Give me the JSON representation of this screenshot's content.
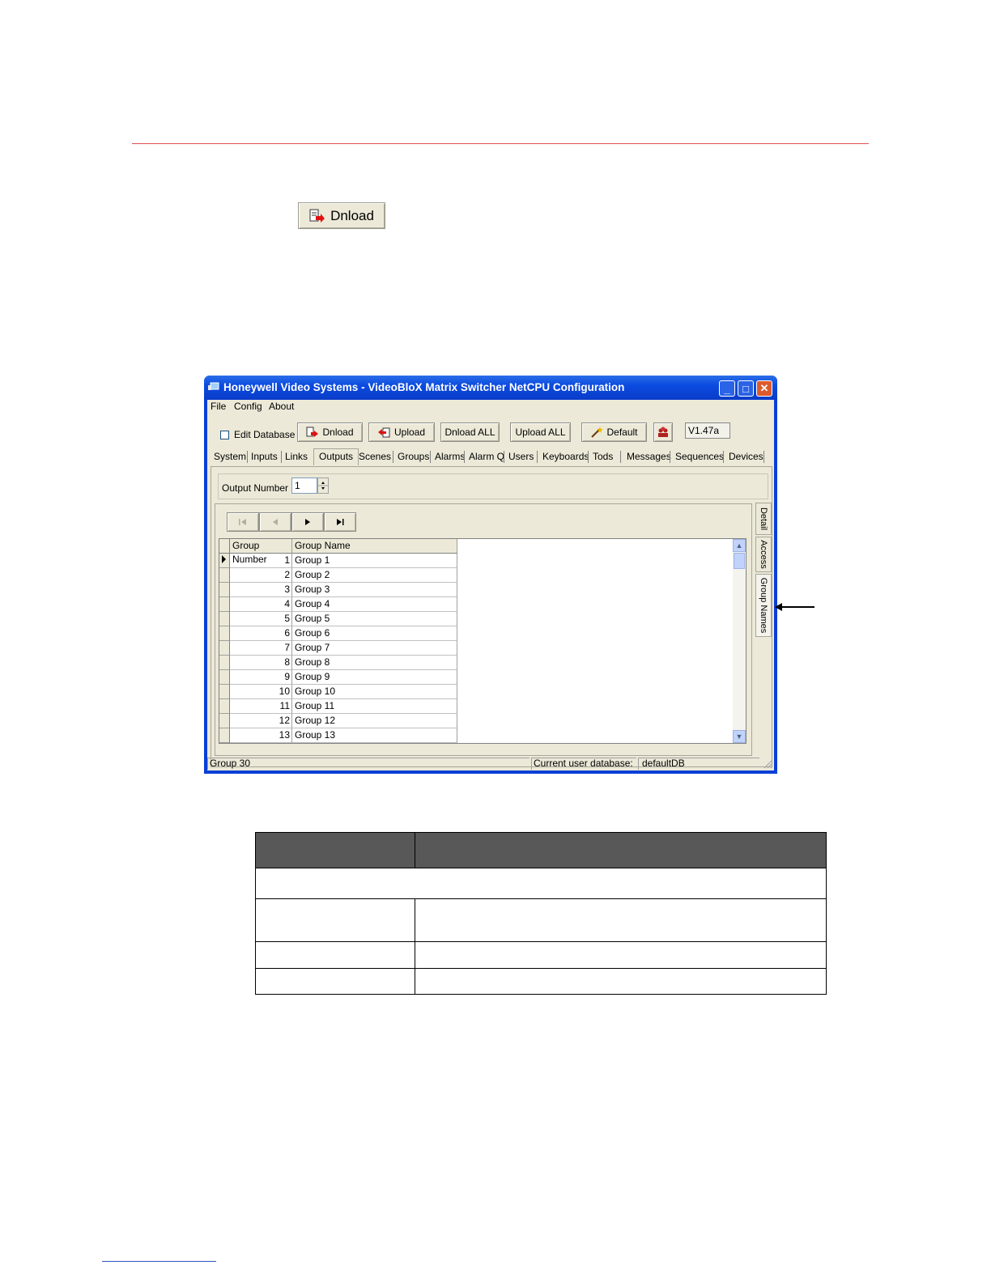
{
  "download_illustration": {
    "label": "Dnload"
  },
  "window": {
    "title": "Honeywell Video Systems - VideoBloX Matrix Switcher NetCPU Configuration",
    "controls": {
      "minimize": "_",
      "maximize": "□",
      "close": "✕"
    },
    "menu": [
      "File",
      "Config",
      "About"
    ],
    "toolbar": {
      "edit_database": {
        "label": "Edit Database",
        "checked": false
      },
      "buttons": [
        "Dnload",
        "Upload",
        "Dnload ALL",
        "Upload ALL",
        "Default"
      ],
      "version": "V1.47a"
    },
    "tabs": [
      "System",
      "Inputs",
      "Links",
      "Outputs",
      "Scenes",
      "Groups",
      "Alarms",
      "Alarm Q",
      "Users",
      "Keyboards",
      "Tods",
      "Messages",
      "Sequences",
      "Devices"
    ],
    "active_tab": "Outputs",
    "output_number": {
      "label": "Output Number",
      "value": "1"
    },
    "side_tabs": [
      "Detail",
      "Access",
      "Group Names"
    ],
    "grid": {
      "columns": [
        "Group Number",
        "Group Name"
      ],
      "rows": [
        {
          "number": "1",
          "name": "Group 1"
        },
        {
          "number": "2",
          "name": "Group 2"
        },
        {
          "number": "3",
          "name": "Group 3"
        },
        {
          "number": "4",
          "name": "Group 4"
        },
        {
          "number": "5",
          "name": "Group 5"
        },
        {
          "number": "6",
          "name": "Group 6"
        },
        {
          "number": "7",
          "name": "Group 7"
        },
        {
          "number": "8",
          "name": "Group 8"
        },
        {
          "number": "9",
          "name": "Group 9"
        },
        {
          "number": "10",
          "name": "Group 10"
        },
        {
          "number": "11",
          "name": "Group 11"
        },
        {
          "number": "12",
          "name": "Group 12"
        },
        {
          "number": "13",
          "name": "Group 13"
        }
      ]
    },
    "status": {
      "left": "Group 30",
      "database_label": "Current user database:",
      "database_value": "defaultDB"
    }
  },
  "colors": {
    "accent_rule": "#e05050",
    "table_header": "#585858",
    "titlebar": "#0a3fd6"
  }
}
